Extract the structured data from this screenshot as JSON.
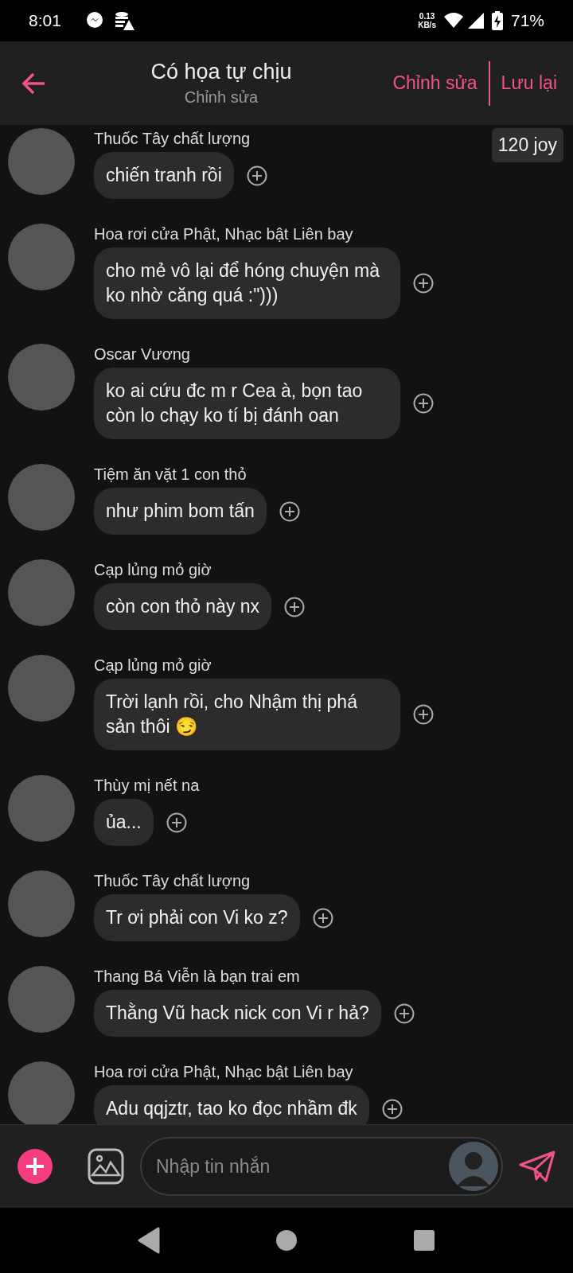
{
  "status_bar": {
    "time": "8:01",
    "speed": "0.13",
    "speed_unit": "KB/s",
    "battery": "71%"
  },
  "header": {
    "title": "Có họa tự chịu",
    "subtitle": "Chỉnh sửa",
    "actions": [
      "Chỉnh sửa",
      "Lưu lại"
    ]
  },
  "balance": "120 joy",
  "messages": [
    {
      "sender": "Thuốc Tây chất lượng",
      "text": "chiến tranh rồi"
    },
    {
      "sender": "Hoa rơi cửa Phật, Nhạc bật Liên bay",
      "text": "cho mẻ vô lại để hóng chuyện mà ko nhờ căng quá :\")))"
    },
    {
      "sender": "Oscar Vương",
      "text": "ko ai cứu đc m r Cea à, bọn tao còn lo chạy ko tí bị đánh oan"
    },
    {
      "sender": "Tiệm ăn vặt 1 con thỏ",
      "text": "như phim bom tấn"
    },
    {
      "sender": "Cạp lủng mỏ giờ",
      "text": "còn con thỏ này nx"
    },
    {
      "sender": "Cạp lủng mỏ giờ",
      "text": "Trời lạnh rồi, cho Nhậm thị phá sản thôi  😏"
    },
    {
      "sender": "Thùy mị nết na",
      "text": "ủa..."
    },
    {
      "sender": "Thuốc Tây chất lượng",
      "text": "Tr ơi phải con Vi ko z?"
    },
    {
      "sender": "Thang Bá Viễn là bạn trai em",
      "text": "Thằng Vũ hack nick con Vi r hả?"
    },
    {
      "sender": "Hoa rơi cửa Phật, Nhạc bật Liên bay",
      "text": "Adu qqjztr, tao ko đọc nhầm đk"
    }
  ],
  "composer": {
    "placeholder": "Nhập tin nhắn"
  }
}
